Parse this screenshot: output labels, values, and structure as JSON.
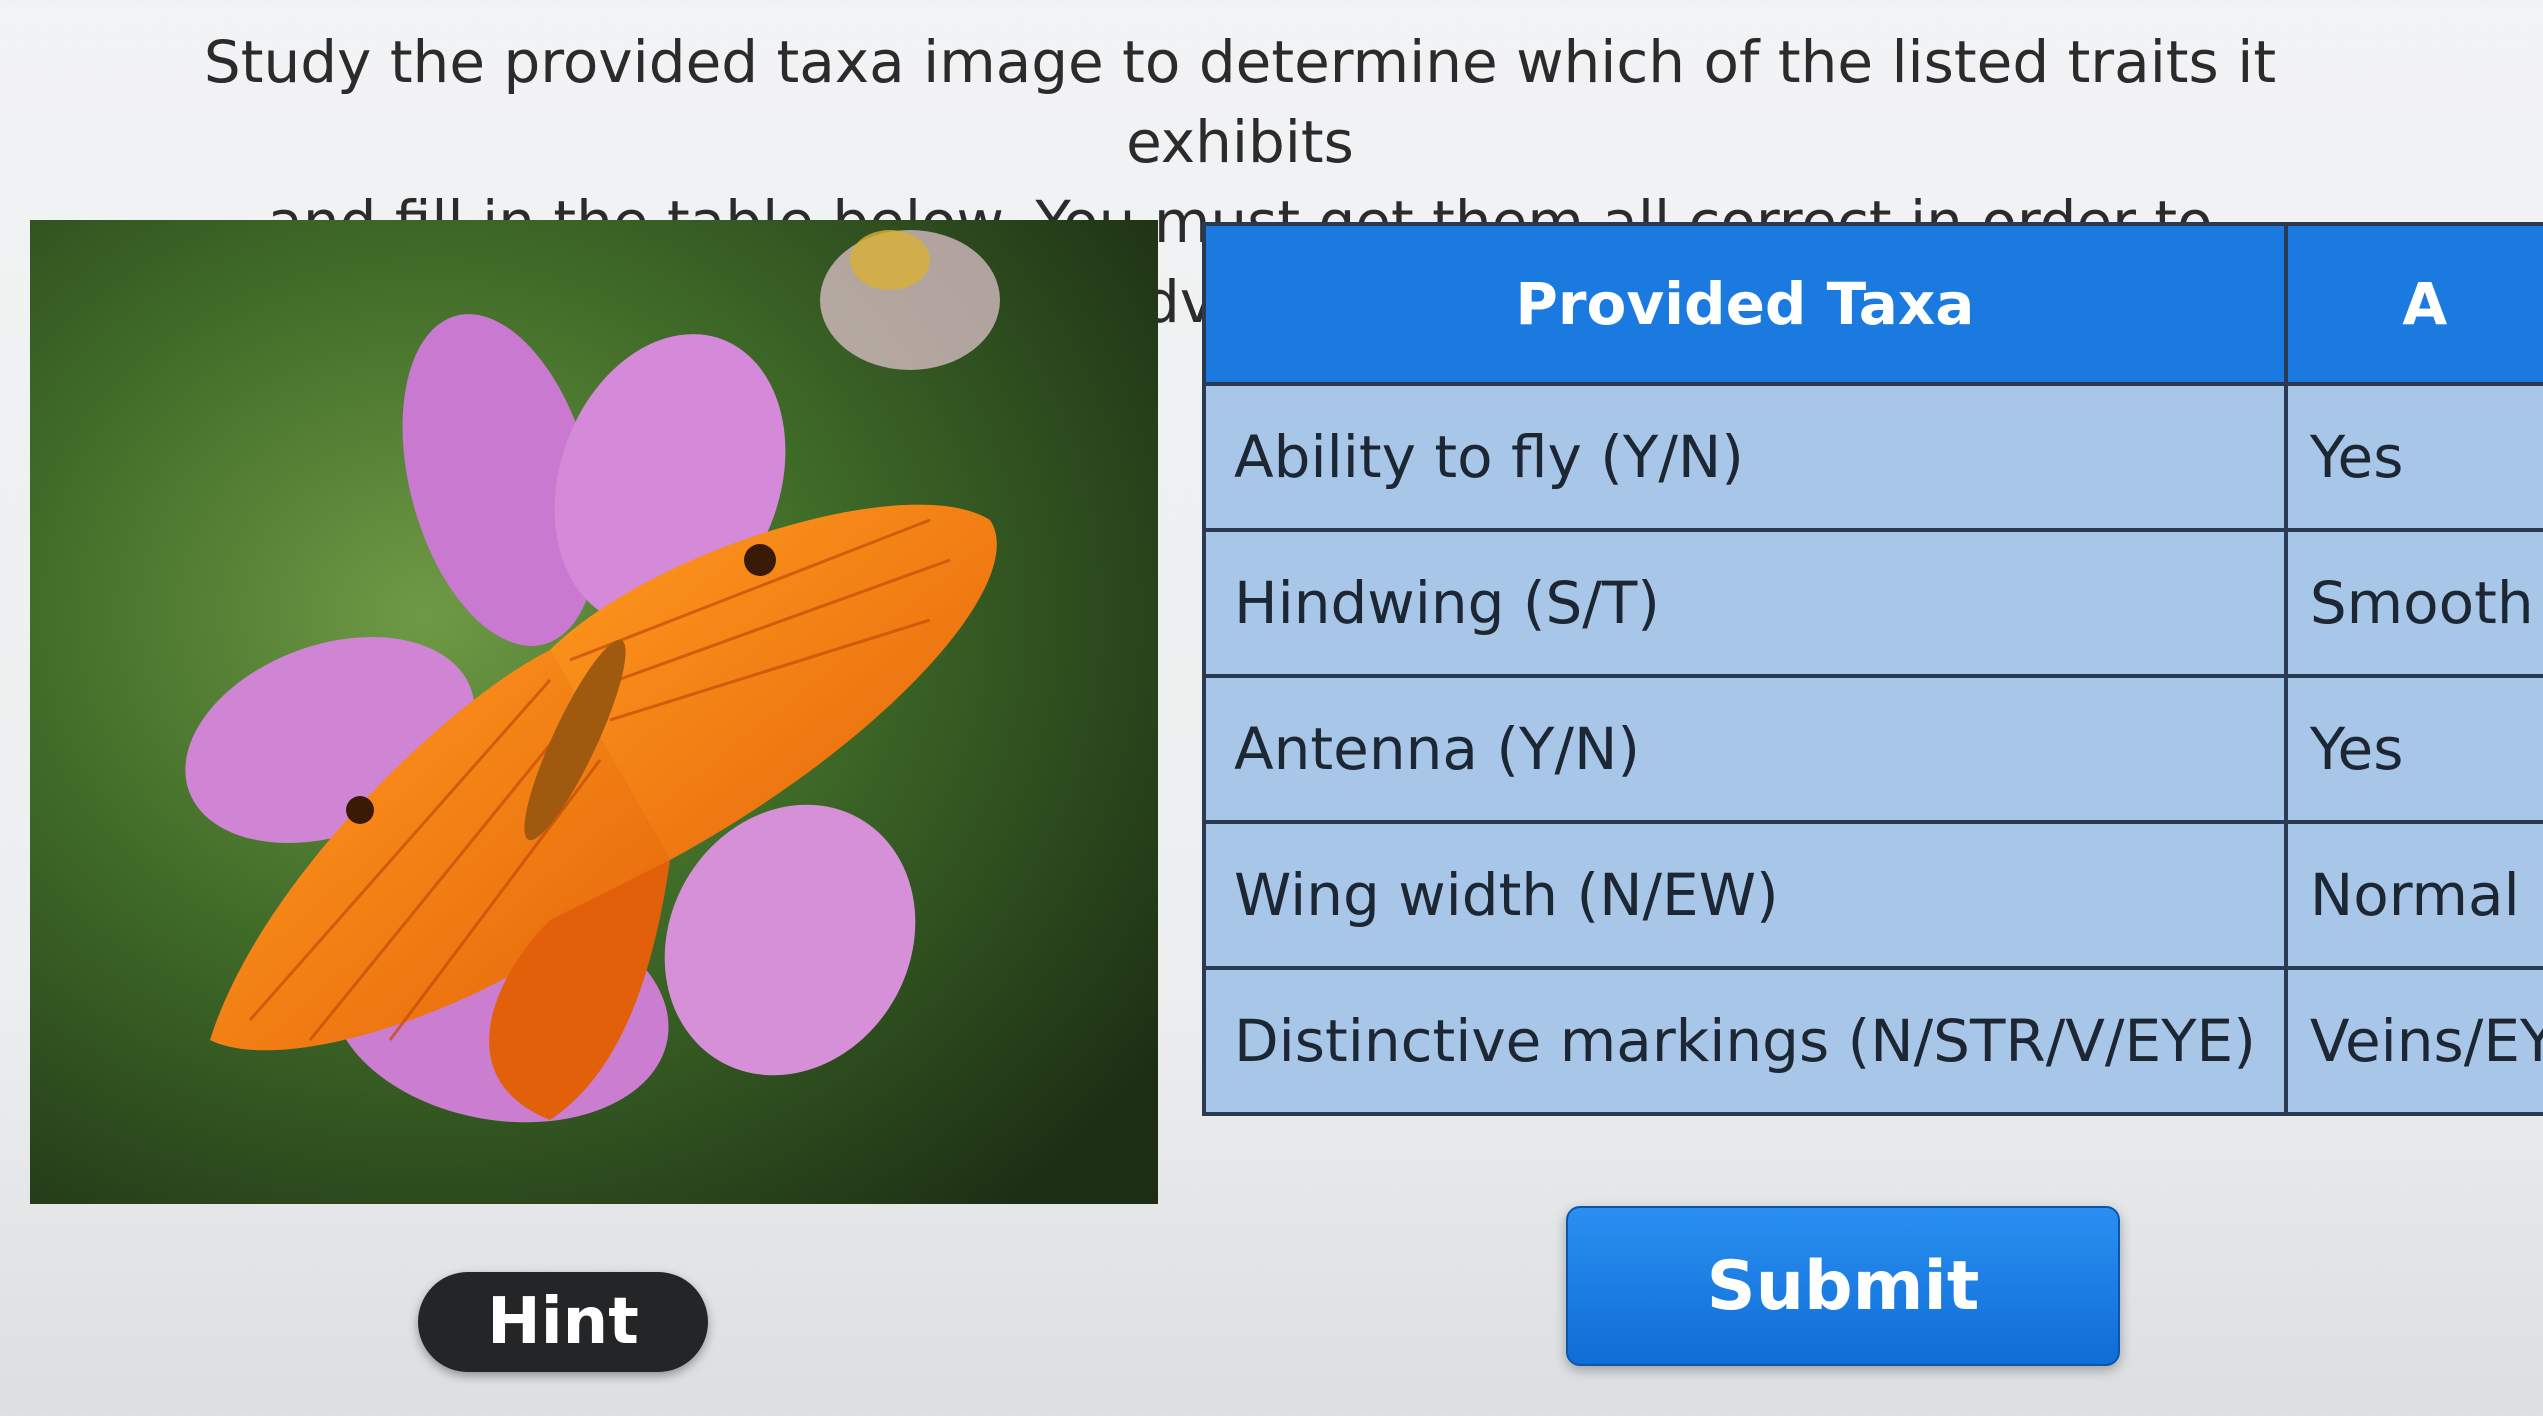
{
  "instructions": {
    "line1": "Study the provided taxa image to determine which of the listed traits it exhibits",
    "line2": "and fill in the table below.  You must get them all correct in order to advance."
  },
  "table": {
    "header": [
      "Provided Taxa",
      "A"
    ],
    "rows": [
      {
        "trait": "Ability to fly (Y/N)",
        "value": "Yes"
      },
      {
        "trait": "Hindwing (S/T)",
        "value": "Smooth"
      },
      {
        "trait": "Antenna (Y/N)",
        "value": "Yes"
      },
      {
        "trait": "Wing width (N/EW)",
        "value": "Normal"
      },
      {
        "trait": "Distinctive markings (N/STR/V/EYE)",
        "value": "Veins/EYE"
      }
    ]
  },
  "buttons": {
    "hint_label": "Hint",
    "submit_label": "Submit"
  },
  "photo": {
    "subject": "orange-butterfly-on-pink-flower"
  },
  "colors": {
    "table_header": "#1a7ae0",
    "table_cell": "#a7c6e8",
    "submit": "#1a7ae0",
    "hint": "#232526"
  }
}
